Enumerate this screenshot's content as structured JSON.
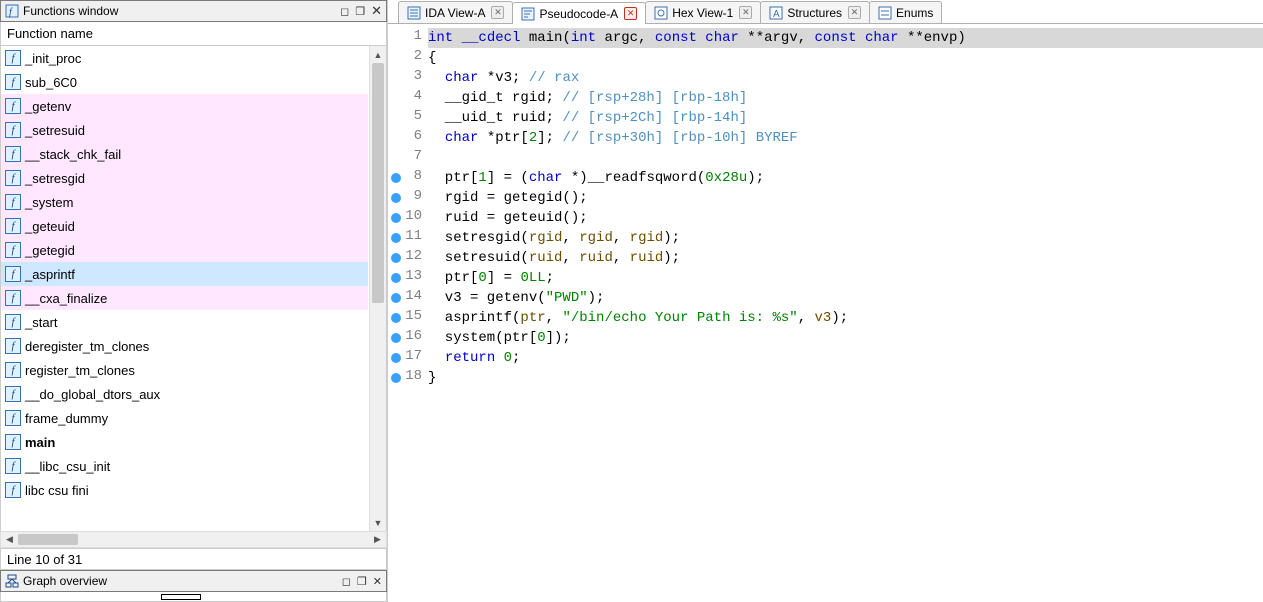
{
  "left": {
    "functions_window_title": "Functions window",
    "column_header": "Function name",
    "items": [
      {
        "name": "_init_proc",
        "hl": false,
        "sel": false,
        "bold": false
      },
      {
        "name": "sub_6C0",
        "hl": false,
        "sel": false,
        "bold": false
      },
      {
        "name": "_getenv",
        "hl": true,
        "sel": false,
        "bold": false
      },
      {
        "name": "_setresuid",
        "hl": true,
        "sel": false,
        "bold": false
      },
      {
        "name": "__stack_chk_fail",
        "hl": true,
        "sel": false,
        "bold": false
      },
      {
        "name": "_setresgid",
        "hl": true,
        "sel": false,
        "bold": false
      },
      {
        "name": "_system",
        "hl": true,
        "sel": false,
        "bold": false
      },
      {
        "name": "_geteuid",
        "hl": true,
        "sel": false,
        "bold": false
      },
      {
        "name": "_getegid",
        "hl": true,
        "sel": false,
        "bold": false
      },
      {
        "name": "_asprintf",
        "hl": true,
        "sel": true,
        "bold": false
      },
      {
        "name": "__cxa_finalize",
        "hl": true,
        "sel": false,
        "bold": false
      },
      {
        "name": "_start",
        "hl": false,
        "sel": false,
        "bold": false
      },
      {
        "name": "deregister_tm_clones",
        "hl": false,
        "sel": false,
        "bold": false
      },
      {
        "name": "register_tm_clones",
        "hl": false,
        "sel": false,
        "bold": false
      },
      {
        "name": "__do_global_dtors_aux",
        "hl": false,
        "sel": false,
        "bold": false
      },
      {
        "name": "frame_dummy",
        "hl": false,
        "sel": false,
        "bold": false
      },
      {
        "name": "main",
        "hl": false,
        "sel": false,
        "bold": true
      },
      {
        "name": "__libc_csu_init",
        "hl": false,
        "sel": false,
        "bold": false
      },
      {
        "name": "  libc csu fini",
        "hl": false,
        "sel": false,
        "bold": false
      }
    ],
    "status": "Line 10 of 31",
    "graph_overview_title": "Graph overview"
  },
  "tabs": [
    {
      "label": "IDA View-A",
      "icon": "ida",
      "closable": true,
      "active": false,
      "red": false
    },
    {
      "label": "Pseudocode-A",
      "icon": "pseudo",
      "closable": true,
      "active": true,
      "red": true
    },
    {
      "label": "Hex View-1",
      "icon": "hex",
      "closable": true,
      "active": false,
      "red": false
    },
    {
      "label": "Structures",
      "icon": "struct",
      "closable": true,
      "active": false,
      "red": false
    },
    {
      "label": "Enums",
      "icon": "enum",
      "closable": false,
      "active": false,
      "red": false
    }
  ],
  "code": {
    "lines": [
      {
        "n": 1,
        "bp": false,
        "hl": true,
        "tokens": [
          {
            "t": "int",
            "c": "kw"
          },
          {
            "t": " __cdecl ",
            "c": "kw"
          },
          {
            "t": "main",
            "c": "ident"
          },
          {
            "t": "(",
            "c": "ident"
          },
          {
            "t": "int",
            "c": "kw"
          },
          {
            "t": " argc, ",
            "c": "ident"
          },
          {
            "t": "const char",
            "c": "kw"
          },
          {
            "t": " **argv, ",
            "c": "ident"
          },
          {
            "t": "const char",
            "c": "kw"
          },
          {
            "t": " **envp)",
            "c": "ident"
          }
        ]
      },
      {
        "n": 2,
        "bp": false,
        "tokens": [
          {
            "t": "{",
            "c": "ident"
          }
        ]
      },
      {
        "n": 3,
        "bp": false,
        "tokens": [
          {
            "t": "  ",
            "c": ""
          },
          {
            "t": "char",
            "c": "kw"
          },
          {
            "t": " *v3; ",
            "c": "ident"
          },
          {
            "t": "// rax",
            "c": "cmt-bl"
          }
        ]
      },
      {
        "n": 4,
        "bp": false,
        "tokens": [
          {
            "t": "  __gid_t rgid; ",
            "c": "ident"
          },
          {
            "t": "// [rsp+28h] [rbp-18h]",
            "c": "cmt-bl"
          }
        ]
      },
      {
        "n": 5,
        "bp": false,
        "tokens": [
          {
            "t": "  __uid_t ruid; ",
            "c": "ident"
          },
          {
            "t": "// [rsp+2Ch] [rbp-14h]",
            "c": "cmt-bl"
          }
        ]
      },
      {
        "n": 6,
        "bp": false,
        "tokens": [
          {
            "t": "  ",
            "c": ""
          },
          {
            "t": "char",
            "c": "kw"
          },
          {
            "t": " *ptr[",
            "c": "ident"
          },
          {
            "t": "2",
            "c": "num"
          },
          {
            "t": "]; ",
            "c": "ident"
          },
          {
            "t": "// [rsp+30h] [rbp-10h] BYREF",
            "c": "cmt-bl"
          }
        ]
      },
      {
        "n": 7,
        "bp": false,
        "tokens": [
          {
            "t": "",
            "c": ""
          }
        ]
      },
      {
        "n": 8,
        "bp": true,
        "tokens": [
          {
            "t": "  ptr[",
            "c": "ident"
          },
          {
            "t": "1",
            "c": "num"
          },
          {
            "t": "] = (",
            "c": "ident"
          },
          {
            "t": "char",
            "c": "kw"
          },
          {
            "t": " *)__readfsqword(",
            "c": "ident"
          },
          {
            "t": "0x28u",
            "c": "hex"
          },
          {
            "t": ");",
            "c": "ident"
          }
        ]
      },
      {
        "n": 9,
        "bp": true,
        "tokens": [
          {
            "t": "  rgid = getegid();",
            "c": "ident"
          }
        ]
      },
      {
        "n": 10,
        "bp": true,
        "tokens": [
          {
            "t": "  ruid = geteuid();",
            "c": "ident"
          }
        ]
      },
      {
        "n": 11,
        "bp": true,
        "tokens": [
          {
            "t": "  setresgid(",
            "c": "ident"
          },
          {
            "t": "rgid",
            "c": "name-hl"
          },
          {
            "t": ", ",
            "c": "ident"
          },
          {
            "t": "rgid",
            "c": "name-hl"
          },
          {
            "t": ", ",
            "c": "ident"
          },
          {
            "t": "rgid",
            "c": "name-hl"
          },
          {
            "t": ");",
            "c": "ident"
          }
        ]
      },
      {
        "n": 12,
        "bp": true,
        "tokens": [
          {
            "t": "  setresuid(",
            "c": "ident"
          },
          {
            "t": "ruid",
            "c": "name-hl"
          },
          {
            "t": ", ",
            "c": "ident"
          },
          {
            "t": "ruid",
            "c": "name-hl"
          },
          {
            "t": ", ",
            "c": "ident"
          },
          {
            "t": "ruid",
            "c": "name-hl"
          },
          {
            "t": ");",
            "c": "ident"
          }
        ]
      },
      {
        "n": 13,
        "bp": true,
        "tokens": [
          {
            "t": "  ptr[",
            "c": "ident"
          },
          {
            "t": "0",
            "c": "num"
          },
          {
            "t": "] = ",
            "c": "ident"
          },
          {
            "t": "0LL",
            "c": "hex"
          },
          {
            "t": ";",
            "c": "ident"
          }
        ]
      },
      {
        "n": 14,
        "bp": true,
        "tokens": [
          {
            "t": "  v3 = getenv(",
            "c": "ident"
          },
          {
            "t": "\"PWD\"",
            "c": "str"
          },
          {
            "t": ");",
            "c": "ident"
          }
        ]
      },
      {
        "n": 15,
        "bp": true,
        "tokens": [
          {
            "t": "  asprintf(",
            "c": "ident"
          },
          {
            "t": "ptr",
            "c": "name-hl"
          },
          {
            "t": ", ",
            "c": "ident"
          },
          {
            "t": "\"/bin/echo Your Path is: %s\"",
            "c": "str"
          },
          {
            "t": ", ",
            "c": "ident"
          },
          {
            "t": "v3",
            "c": "name-hl"
          },
          {
            "t": ");",
            "c": "ident"
          }
        ]
      },
      {
        "n": 16,
        "bp": true,
        "tokens": [
          {
            "t": "  system(ptr[",
            "c": "ident"
          },
          {
            "t": "0",
            "c": "num"
          },
          {
            "t": "]);",
            "c": "ident"
          }
        ]
      },
      {
        "n": 17,
        "bp": true,
        "tokens": [
          {
            "t": "  ",
            "c": ""
          },
          {
            "t": "return",
            "c": "kw"
          },
          {
            "t": " ",
            "c": ""
          },
          {
            "t": "0",
            "c": "num"
          },
          {
            "t": ";",
            "c": "ident"
          }
        ]
      },
      {
        "n": 18,
        "bp": true,
        "tokens": [
          {
            "t": "}",
            "c": "ident"
          }
        ]
      }
    ]
  }
}
